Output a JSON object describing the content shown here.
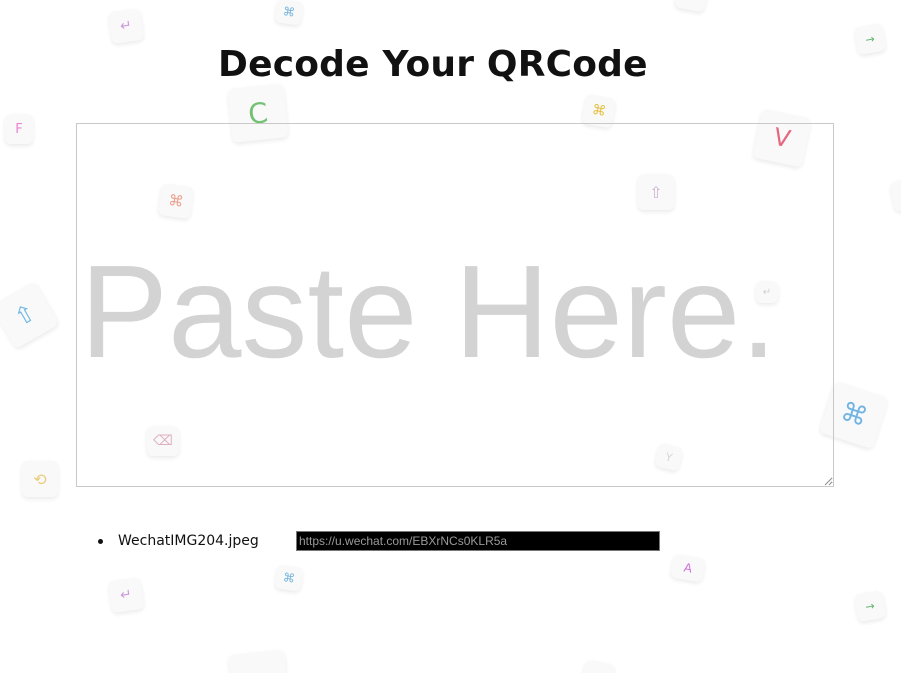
{
  "header": {
    "title": "Decode Your QRCode"
  },
  "paste_area": {
    "placeholder": "Paste Here."
  },
  "results": [
    {
      "filename": "WechatIMG204.jpeg",
      "url": "https://u.wechat.com/EBXrNCs0KLR5a"
    }
  ],
  "background_keys": [
    {
      "glyph": "↵",
      "icon": "return-key-icon",
      "color": "#c58ad6"
    },
    {
      "glyph": "⌘",
      "icon": "command-key-icon",
      "color": "#5ba8d8"
    },
    {
      "glyph": "→",
      "icon": "arrow-right-key-icon",
      "color": "#43a855"
    },
    {
      "glyph": "F",
      "icon": "f-key-icon",
      "color": "#e56fc9"
    },
    {
      "glyph": "C",
      "icon": "c-key-icon",
      "color": "#5bb85b"
    },
    {
      "glyph": "⌘",
      "icon": "command-key-icon",
      "color": "#e0b520"
    },
    {
      "glyph": "V",
      "icon": "v-key-icon",
      "color": "#e0506a"
    },
    {
      "glyph": "⌘",
      "icon": "command-key-icon",
      "color": "#e8907a"
    },
    {
      "glyph": "⇧",
      "icon": "shift-key-icon",
      "color": "#c9a6c9"
    },
    {
      "glyph": "⇧",
      "icon": "shift-key-icon",
      "color": "#5aaee0"
    },
    {
      "glyph": "↵",
      "icon": "return-key-icon",
      "color": "#c7c7c7"
    },
    {
      "glyph": "⌘",
      "icon": "command-key-icon",
      "color": "#59a8e0"
    },
    {
      "glyph": "⌫",
      "icon": "delete-key-icon",
      "color": "#d9a3b6"
    },
    {
      "glyph": "⟲",
      "icon": "undo-key-icon",
      "color": "#e6c46a"
    },
    {
      "glyph": "Y",
      "icon": "y-key-icon",
      "color": "#cfcfcf"
    },
    {
      "glyph": "↵",
      "icon": "return-key-icon",
      "color": "#c58ad6"
    },
    {
      "glyph": "⌘",
      "icon": "command-key-icon",
      "color": "#5ba8d8"
    },
    {
      "glyph": "A",
      "icon": "a-key-icon",
      "color": "#c85ad6"
    },
    {
      "glyph": "→",
      "icon": "arrow-right-key-icon",
      "color": "#43a855"
    }
  ]
}
